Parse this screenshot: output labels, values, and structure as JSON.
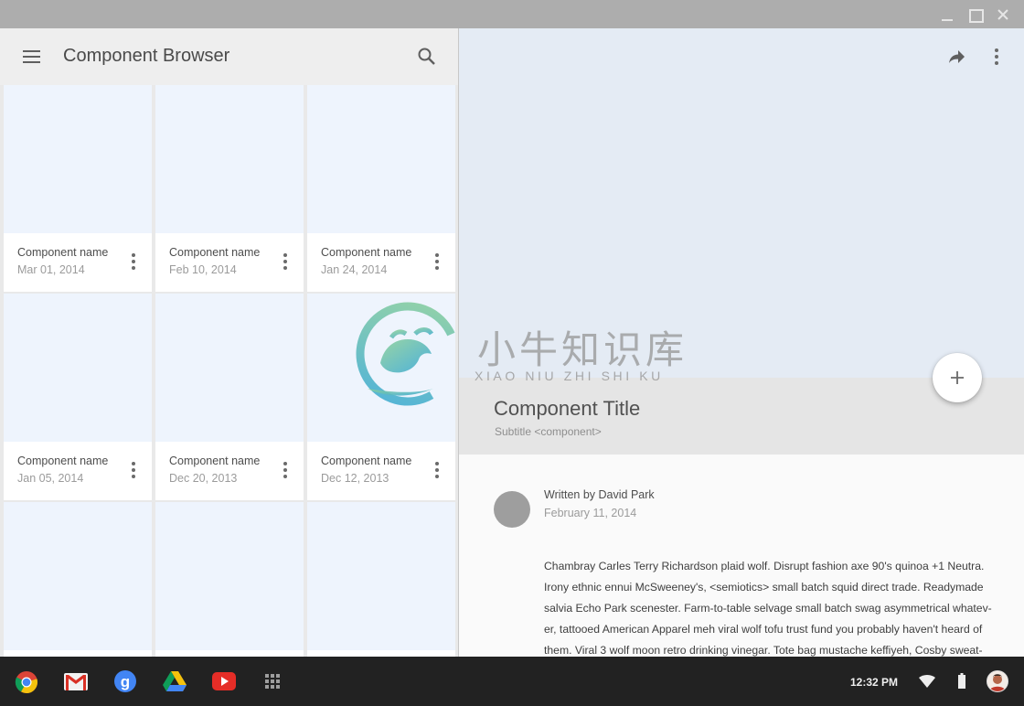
{
  "app": {
    "title": "Component Browser"
  },
  "cards": [
    {
      "name": "Component name",
      "date": "Mar 01, 2014"
    },
    {
      "name": "Component name",
      "date": "Feb 10, 2014"
    },
    {
      "name": "Component name",
      "date": "Jan 24, 2014"
    },
    {
      "name": "Component name",
      "date": "Jan 05, 2014"
    },
    {
      "name": "Component name",
      "date": "Dec 20, 2013"
    },
    {
      "name": "Component name",
      "date": "Dec 12, 2013"
    },
    {
      "name": "",
      "date": ""
    },
    {
      "name": "",
      "date": ""
    },
    {
      "name": "",
      "date": ""
    }
  ],
  "detail": {
    "title": "Component Title",
    "subtitle": "Subtitle <component>",
    "author": "Written by David Park",
    "date": "February 11, 2014",
    "body_lines": [
      "Chambray Carles Terry Richardson plaid wolf. Disrupt fashion axe 90's quinoa +1 Neutra.",
      "Irony ethnic ennui McSweeney's, <semiotics> small batch squid direct trade. Readymade",
      "salvia Echo Park scenester. Farm-to-table selvage small batch swag asymmetrical whatev-",
      "er, tattooed American Apparel meh viral wolf tofu trust fund you probably haven't heard of",
      "them. Viral 3 wolf moon retro drinking  vinegar. Tote bag mustache keffiyeh, Cosby sweat-"
    ]
  },
  "watermark": {
    "cn": "小牛知识库",
    "en": "XIAO NIU ZHI SHI KU"
  },
  "shelf": {
    "apps": [
      "chrome-icon",
      "gmail-icon",
      "google-search-icon",
      "drive-icon",
      "youtube-icon",
      "app-launcher-icon"
    ],
    "time": "12:32 PM"
  },
  "colors": {
    "card_image": "#eef4fd",
    "hero": "#e4ebf4",
    "shelf": "#222222",
    "titlebar": "#adadad"
  }
}
